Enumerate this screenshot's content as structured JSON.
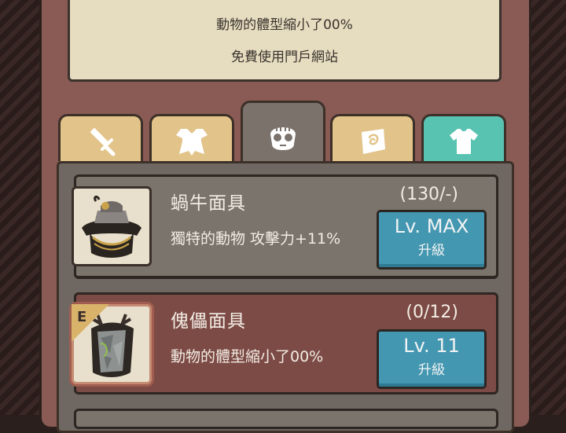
{
  "info_panel": {
    "line1": "動物的體型縮小了00%",
    "line2": "免費使用門戶網站"
  },
  "tabs": [
    {
      "icon": "sword-icon",
      "active": false
    },
    {
      "icon": "armor-icon",
      "active": false
    },
    {
      "icon": "mask-icon",
      "active": true
    },
    {
      "icon": "scroll-icon",
      "active": false
    },
    {
      "icon": "shirt-icon",
      "active": false
    }
  ],
  "items": [
    {
      "name": "蝸牛面具",
      "description": "獨特的動物 攻擊力+11%",
      "count": "(130/-)",
      "level": "Lv. MAX",
      "action": "升級",
      "icon": "snail-mask-icon"
    },
    {
      "name": "傀儡面具",
      "description": "動物的體型縮小了00%",
      "count": "(0/12)",
      "level": "Lv. 11",
      "action": "升級",
      "badge": "E",
      "icon": "puppet-mask-icon"
    }
  ],
  "colors": {
    "frame": "#8a5a55",
    "tab_gold": "#e2c48a",
    "tab_teal": "#59c3b2",
    "button_blue": "#4497b1",
    "selected_row": "#7d4b46"
  }
}
